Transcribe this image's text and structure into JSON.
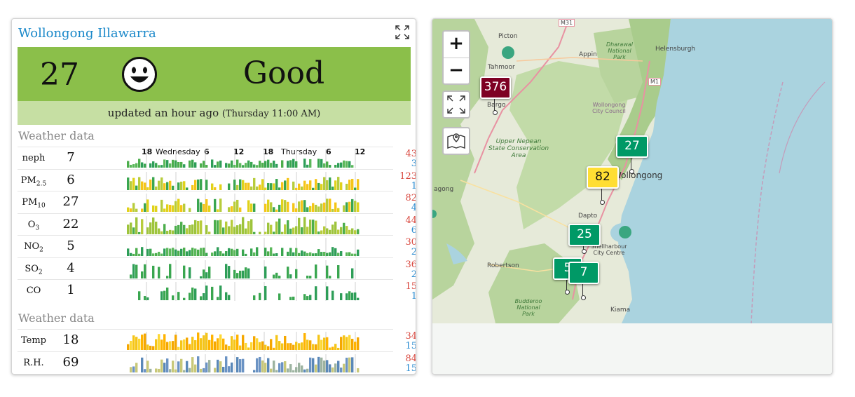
{
  "station": {
    "title": "Wollongong Illawarra",
    "aqi_value": "27",
    "aqi_category": "Good",
    "updated_text": "updated an hour ago",
    "updated_time": "(Thursday 11:00 AM)",
    "band_color": "#8bbf4a"
  },
  "sections": {
    "pollutants_label": "Weather data",
    "weather_label": "Weather data"
  },
  "time_axis": [
    "18",
    "Wednesday",
    "6",
    "12",
    "18",
    "Thursday",
    "6",
    "12"
  ],
  "pollutants": [
    {
      "name": "neph",
      "value": "7",
      "max": "43",
      "min": "3"
    },
    {
      "name": "PM",
      "sub": "2.5",
      "value": "6",
      "max": "123",
      "min": "1"
    },
    {
      "name": "PM",
      "sub": "10",
      "value": "27",
      "max": "82",
      "min": "4"
    },
    {
      "name": "O",
      "sub": "3",
      "value": "22",
      "max": "44",
      "min": "6"
    },
    {
      "name": "NO",
      "sub": "2",
      "value": "5",
      "max": "30",
      "min": "2"
    },
    {
      "name": "SO",
      "sub": "2",
      "value": "4",
      "max": "36",
      "min": "2"
    },
    {
      "name": "CO",
      "value": "1",
      "max": "15",
      "min": "1"
    }
  ],
  "weather": [
    {
      "name": "Temp",
      "value": "18",
      "max": "34",
      "min": "15"
    },
    {
      "name": "R.H.",
      "value": "69",
      "max": "84",
      "min": "15"
    }
  ],
  "map": {
    "zoom_in": "+",
    "zoom_out": "−",
    "place_labels": [
      "Picton",
      "Appin",
      "Tahmoor",
      "Helensburgh",
      "Dharawal National Park",
      "Bargo",
      "Upper Nepean State Conservation Area",
      "Wollongong City Council",
      "Wollongong",
      "Dapto",
      "Shellharbour City Centre",
      "Robertson",
      "Budderoo National Park",
      "Kiama",
      "M31",
      "M1",
      "agong"
    ],
    "markers": [
      {
        "value": "376",
        "color": "#7e0023",
        "text_color": "#ffffff"
      },
      {
        "value": "27",
        "color": "#009966",
        "text_color": "#ffffff"
      },
      {
        "value": "82",
        "color": "#ffde33",
        "text_color": "#111111"
      },
      {
        "value": "25",
        "color": "#009966",
        "text_color": "#ffffff"
      },
      {
        "value": "5",
        "color": "#009966",
        "text_color": "#ffffff"
      },
      {
        "value": "7",
        "color": "#009966",
        "text_color": "#ffffff"
      }
    ],
    "colors": {
      "land": "#e9ede0",
      "forest": "#b5d29a",
      "water": "#aad3df"
    }
  }
}
